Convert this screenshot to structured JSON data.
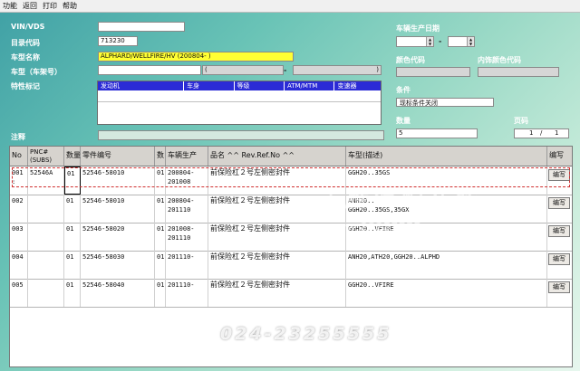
{
  "menu": {
    "items": [
      "功能",
      "返回",
      "打印",
      "帮助"
    ]
  },
  "form": {
    "vin_label": "VIN/VDS",
    "vin_value": "",
    "catalog_label": "目录代码",
    "catalog_value": "713230",
    "model_name_label": "车型名称",
    "model_name_value": "ALPHARD/WELLFIRE/HV (200804-    )",
    "model_code_label": "车型（车架号）",
    "model_code_value": "",
    "model_code_part2": "(",
    "model_code_sep": "-",
    "model_code_part3": ")",
    "spec_label": "特性标记",
    "spec_columns": [
      "发动机",
      "车身",
      "等级",
      "ATM/MTM",
      "变速器"
    ],
    "note_label": "注释",
    "note_value": ""
  },
  "right": {
    "prod_date_label": "车辆生产日期",
    "prod_date_sep": "-",
    "color_code_label": "颜色代码",
    "interior_color_label": "内饰颜色代码",
    "condition_label": "条件",
    "condition_button": "现标条件关闭",
    "qty_label": "数量",
    "qty_value": "5",
    "page_label": "页码",
    "page_current": "1",
    "page_sep": "/",
    "page_total": "1"
  },
  "table": {
    "headers": {
      "no": "No",
      "pnc": "PNC#",
      "pnc_sub": "(SUBS)",
      "qty_short": "数量",
      "part_no": "零件编号",
      "qty": "数",
      "prod": "车辆生产",
      "name": "品名 ^^ Rev.Ref.No ^^",
      "model_desc": "车型(描述)",
      "edit": "编写"
    },
    "rows": [
      {
        "no": "001",
        "no2": ":",
        "pnc": "52546A",
        "qty_short": "01",
        "part_no": "52546-58010",
        "qty": "01",
        "prod1": "200804-",
        "prod2": "201008",
        "name": "前保险杠２号左侧密封件",
        "model1": "GGH20..35GS",
        "model2": "",
        "edit": "编写"
      },
      {
        "no": "002",
        "no2": "",
        "pnc": "",
        "qty_short": "01",
        "part_no": "52546-58010",
        "qty": "01",
        "prod1": "200804-",
        "prod2": "201110",
        "name": "前保险杠２号左侧密封件",
        "model1": "ANH20..",
        "model2": "GGH20..35GS,35GX",
        "edit": "编写"
      },
      {
        "no": "003",
        "no2": "",
        "pnc": "",
        "qty_short": "01",
        "part_no": "52546-58020",
        "qty": "01",
        "prod1": "201008-",
        "prod2": "201110",
        "name": "前保险杠２号左侧密封件",
        "model1": "GGH20..VFIRE",
        "model2": "",
        "edit": "编写"
      },
      {
        "no": "004",
        "no2": "",
        "pnc": "",
        "qty_short": "01",
        "part_no": "52546-58030",
        "qty": "01",
        "prod1": "201110-",
        "prod2": "",
        "name": "前保险杠２号左侧密封件",
        "model1": "ANH20,ATH20,GGH20..ALPHD",
        "model2": "",
        "edit": "编写"
      },
      {
        "no": "005",
        "no2": "",
        "pnc": "",
        "qty_short": "01",
        "part_no": "52546-58040",
        "qty": "01",
        "prod1": "201110-",
        "prod2": "",
        "name": "前保险杠２号左侧密封件",
        "model1": "GGH20..VFIRE",
        "model2": "",
        "edit": "编写"
      }
    ]
  },
  "watermark": {
    "brand": "丰胜汽配在线",
    "url": "www.23255555.com",
    "phone": "024-23255555"
  },
  "colors": {
    "selection_outline": "#d03030",
    "spec_header": "#2b2bd6",
    "model_highlight": "#ffff33"
  }
}
